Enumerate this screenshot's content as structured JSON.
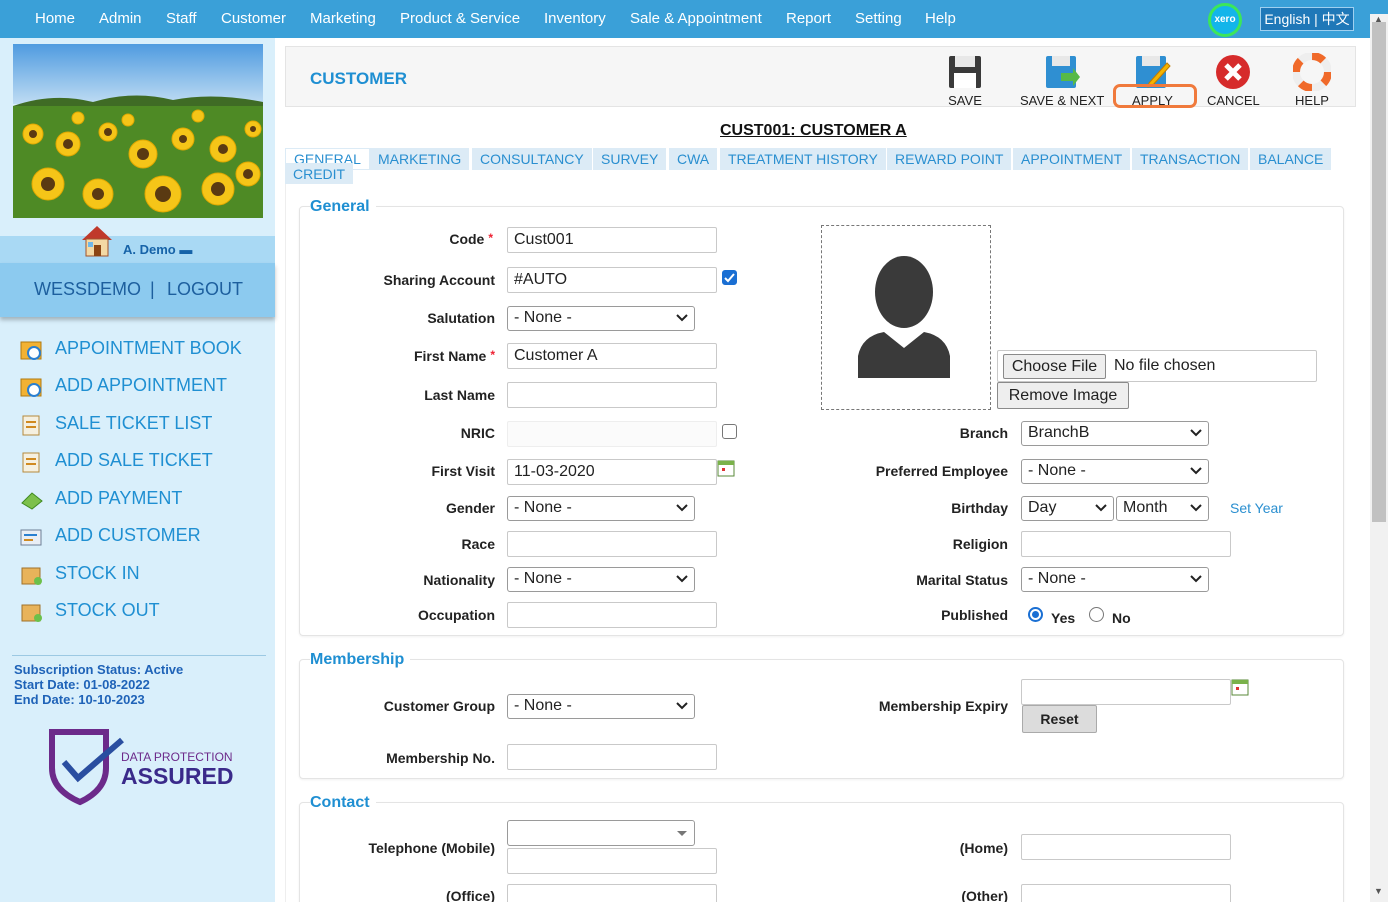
{
  "nav": {
    "items": [
      "Home",
      "Admin",
      "Staff",
      "Customer",
      "Marketing",
      "Product & Service",
      "Inventory",
      "Sale & Appointment",
      "Report",
      "Setting",
      "Help"
    ],
    "xero_label": "xero",
    "language": "English | 中文"
  },
  "sidebar": {
    "user_name": "A. Demo",
    "account": "WESSDEMO",
    "separator": "|",
    "logout": "LOGOUT",
    "menu": [
      {
        "label": "APPOINTMENT BOOK",
        "icon": "calendar-clock-icon"
      },
      {
        "label": "ADD APPOINTMENT",
        "icon": "calendar-add-icon"
      },
      {
        "label": "SALE TICKET LIST",
        "icon": "ticket-list-icon"
      },
      {
        "label": "ADD SALE TICKET",
        "icon": "ticket-add-icon"
      },
      {
        "label": "ADD PAYMENT",
        "icon": "money-icon"
      },
      {
        "label": "ADD CUSTOMER",
        "icon": "customer-card-icon"
      },
      {
        "label": "STOCK IN",
        "icon": "box-in-icon"
      },
      {
        "label": "STOCK OUT",
        "icon": "box-out-icon"
      }
    ],
    "subscription": {
      "status": "Subscription Status: Active",
      "start": "Start Date: 01-08-2022",
      "end": "End Date: 10-10-2023"
    },
    "badge": {
      "line1": "DATA PROTECTION",
      "line2": "ASSURED"
    }
  },
  "header": {
    "title": "CUSTOMER",
    "toolbar": {
      "save": "SAVE",
      "save_next": "SAVE & NEXT",
      "apply": "APPLY",
      "cancel": "CANCEL",
      "help": "HELP"
    }
  },
  "record_title": "CUST001: CUSTOMER A",
  "tabs": [
    "GENERAL",
    "MARKETING",
    "CONSULTANCY",
    "SURVEY",
    "CWA",
    "TREATMENT HISTORY",
    "REWARD POINT",
    "APPOINTMENT",
    "TRANSACTION",
    "BALANCE",
    "CREDIT"
  ],
  "general": {
    "section": "General",
    "code": {
      "label": "Code",
      "value": "Cust001"
    },
    "sharing": {
      "label": "Sharing Account",
      "value": "#AUTO"
    },
    "salutation": {
      "label": "Salutation",
      "value": "- None -"
    },
    "first_name": {
      "label": "First Name",
      "value": "Customer A"
    },
    "last_name": {
      "label": "Last Name",
      "value": ""
    },
    "nric": {
      "label": "NRIC",
      "value": ""
    },
    "first_visit": {
      "label": "First Visit",
      "value": "11-03-2020"
    },
    "gender": {
      "label": "Gender",
      "value": "- None -"
    },
    "race": {
      "label": "Race",
      "value": ""
    },
    "nationality": {
      "label": "Nationality",
      "value": "- None -"
    },
    "occupation": {
      "label": "Occupation",
      "value": ""
    },
    "choose_file": "Choose File",
    "no_file": "No file chosen",
    "remove_image": "Remove Image",
    "branch": {
      "label": "Branch",
      "value": "BranchB"
    },
    "preferred_employee": {
      "label": "Preferred Employee",
      "value": "- None -"
    },
    "birthday": {
      "label": "Birthday",
      "day": "Day",
      "month": "Month",
      "set_year": "Set Year"
    },
    "religion": {
      "label": "Religion",
      "value": ""
    },
    "marital_status": {
      "label": "Marital Status",
      "value": "- None -"
    },
    "published": {
      "label": "Published",
      "yes": "Yes",
      "no": "No"
    }
  },
  "membership": {
    "section": "Membership",
    "customer_group": {
      "label": "Customer Group",
      "value": "- None -"
    },
    "membership_no": {
      "label": "Membership No.",
      "value": ""
    },
    "expiry": {
      "label": "Membership Expiry",
      "value": ""
    },
    "reset": "Reset"
  },
  "contact": {
    "section": "Contact",
    "mobile": {
      "label": "Telephone (Mobile)",
      "value": ""
    },
    "home": {
      "label": "(Home)",
      "value": ""
    },
    "office": {
      "label": "(Office)",
      "value": ""
    },
    "other": {
      "label": "(Other)",
      "value": ""
    }
  }
}
